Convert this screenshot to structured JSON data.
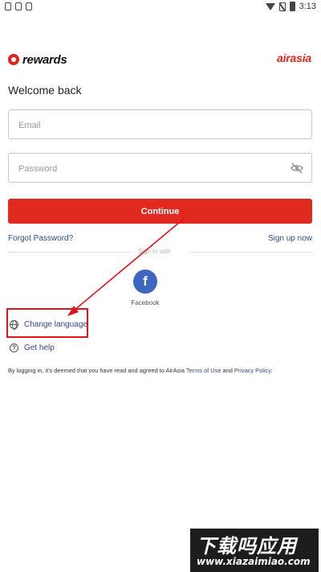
{
  "status_bar": {
    "time": "3:13",
    "icons_left": [
      "shield-icon",
      "clipboard-icon",
      "a-icon"
    ],
    "icons_right": [
      "wifi-icon",
      "no-sim-icon",
      "battery-icon"
    ]
  },
  "header": {
    "rewards_logo": "rewards",
    "brand_logo": "airasia",
    "brand_color": "#e1251b"
  },
  "page_title": "Welcome back",
  "form": {
    "email_placeholder": "Email",
    "email_value": "",
    "password_placeholder": "Password",
    "password_value": "",
    "continue_label": "Continue"
  },
  "links": {
    "forgot_password": "Forgot Password?",
    "sign_up": "Sign up now"
  },
  "social": {
    "divider_text": "Sign in with",
    "facebook_label": "Facebook",
    "facebook_icon_glyph": "f",
    "facebook_color": "#3e68c0"
  },
  "actions": {
    "change_language": "Change language",
    "get_help": "Get help"
  },
  "terms": {
    "prefix": "By logging in, it's deemed that you have read and agreed to AirAsia ",
    "terms_of_use": "Terms of Use",
    "and": " and ",
    "privacy_policy": "Privacy Policy",
    "suffix": "."
  },
  "annotation": {
    "highlight_color": "#e0141b"
  },
  "watermark": {
    "title": "下载吗应用",
    "url": "www.xiazaimiao.com"
  }
}
